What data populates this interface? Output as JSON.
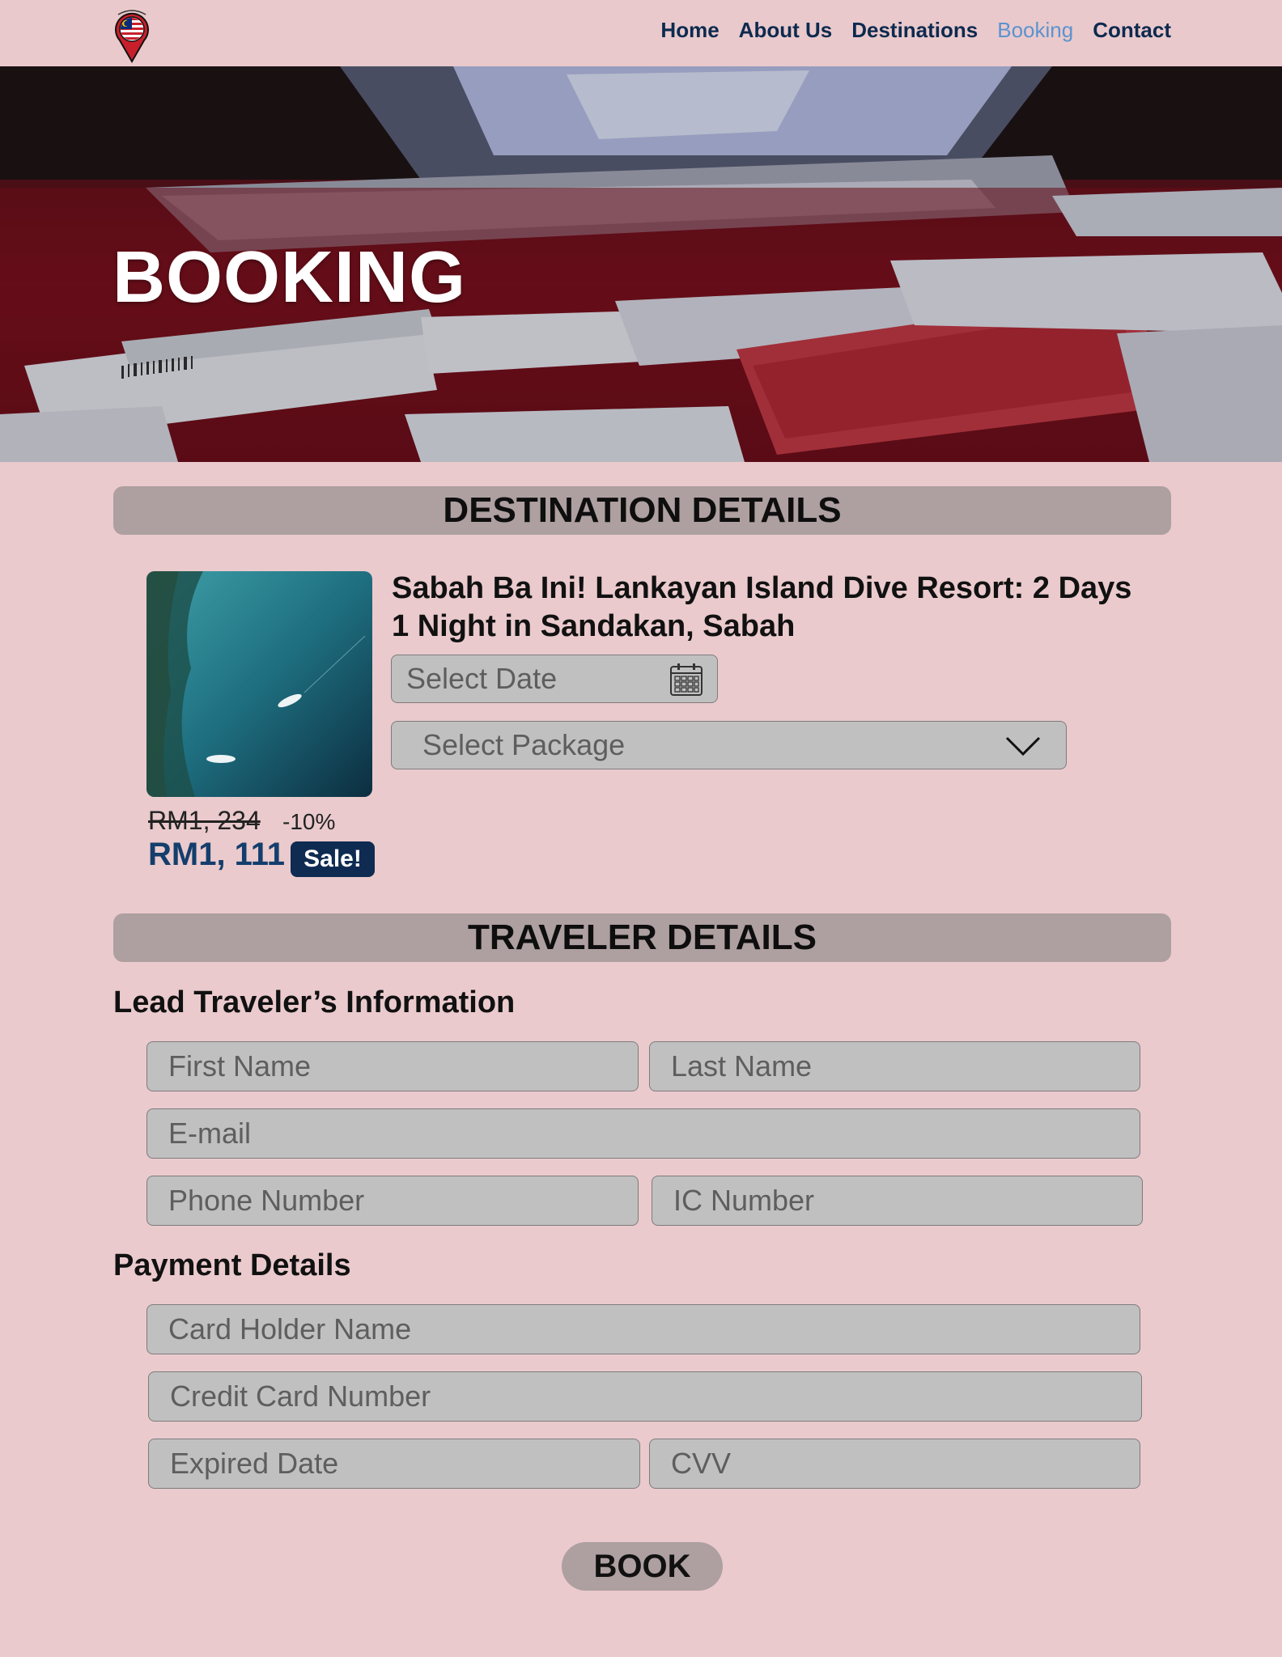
{
  "nav": {
    "items": [
      {
        "label": "Home",
        "active": false
      },
      {
        "label": "About Us",
        "active": false
      },
      {
        "label": "Destinations",
        "active": false
      },
      {
        "label": "Booking",
        "active": true
      },
      {
        "label": "Contact",
        "active": false
      }
    ]
  },
  "hero": {
    "title": "BOOKING"
  },
  "destination": {
    "section_title": "DESTINATION DETAILS",
    "title": "Sabah Ba Ini! Lankayan Island Dive Resort: 2 Days 1 Night in Sandakan, Sabah",
    "date_placeholder": "Select Date",
    "package_placeholder": "Select Package",
    "old_price": "RM1, 234",
    "discount": "-10%",
    "new_price": "RM1, 111",
    "sale_badge": "Sale!"
  },
  "traveler": {
    "section_title": "TRAVELER DETAILS",
    "lead_heading": "Lead Traveler’s Information",
    "first_name": "First Name",
    "last_name": "Last Name",
    "email": "E-mail",
    "phone": "Phone Number",
    "ic": "IC Number"
  },
  "payment": {
    "heading": "Payment Details",
    "card_holder": "Card Holder Name",
    "card_number": "Credit Card Number",
    "expiry": "Expired Date",
    "cvv": "CVV"
  },
  "book_button": "BOOK",
  "colors": {
    "background": "#eacacd",
    "nav_text": "#0d2a4f",
    "nav_active": "#5b93cf",
    "section_bar": "#ae9fa0",
    "input_bg": "#c1c0c1",
    "price": "#143e6c",
    "badge": "#0f2b52"
  }
}
